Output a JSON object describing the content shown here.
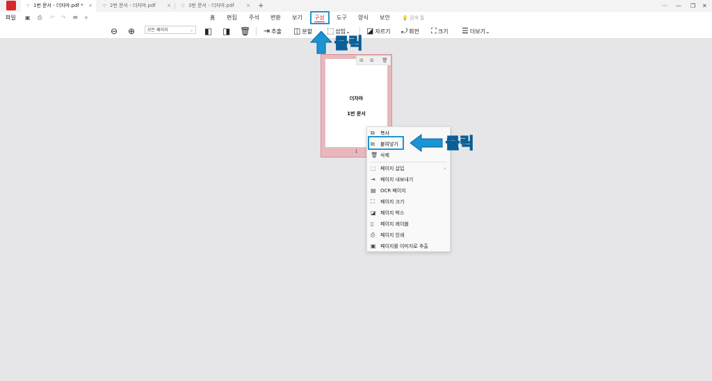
{
  "tabs": [
    {
      "label": "1번 문서 - 더자마.pdf *",
      "close": "×",
      "active": true
    },
    {
      "label": "2번 문서 - 더자마.pdf",
      "close": "×",
      "active": false
    },
    {
      "label": "3번 문서 - 더자마.pdf",
      "close": "×",
      "active": false
    }
  ],
  "new_tab": "+",
  "window_controls": {
    "more": "···",
    "minimize": "—",
    "restore": "❐",
    "close": "✕"
  },
  "menu": {
    "file": "파일",
    "items": [
      "홈",
      "편집",
      "주석",
      "변환",
      "보기",
      "구성",
      "도구",
      "양식",
      "보안"
    ],
    "active_index": 5,
    "search": "검색 툴"
  },
  "toolbar": {
    "page_select": "모든 페이지",
    "extract": "추출",
    "split": "분할",
    "insert": "삽입",
    "crop": "자르기",
    "rotate": "회전",
    "size": "크기",
    "more": "더보기"
  },
  "thumbnail": {
    "line1": "더자마",
    "line2": "1번 문서",
    "page_number": "1"
  },
  "context_menu": {
    "items": [
      "복사",
      "붙여넣기",
      "삭제",
      "페이지 삽입",
      "페이지 내보내기",
      "OCR 페이지",
      "페이지 크기",
      "페이지 박스",
      "페이지 레이블",
      "페이지 인쇄",
      "페이지를 이미지로 추출"
    ],
    "submenu_chevron": "›"
  },
  "annotations": {
    "click_top": "클릭",
    "click_right": "클릭"
  },
  "colors": {
    "brand": "#d8262a",
    "highlight": "#1b94d4",
    "thumb_selected": "#e8b8bc"
  }
}
